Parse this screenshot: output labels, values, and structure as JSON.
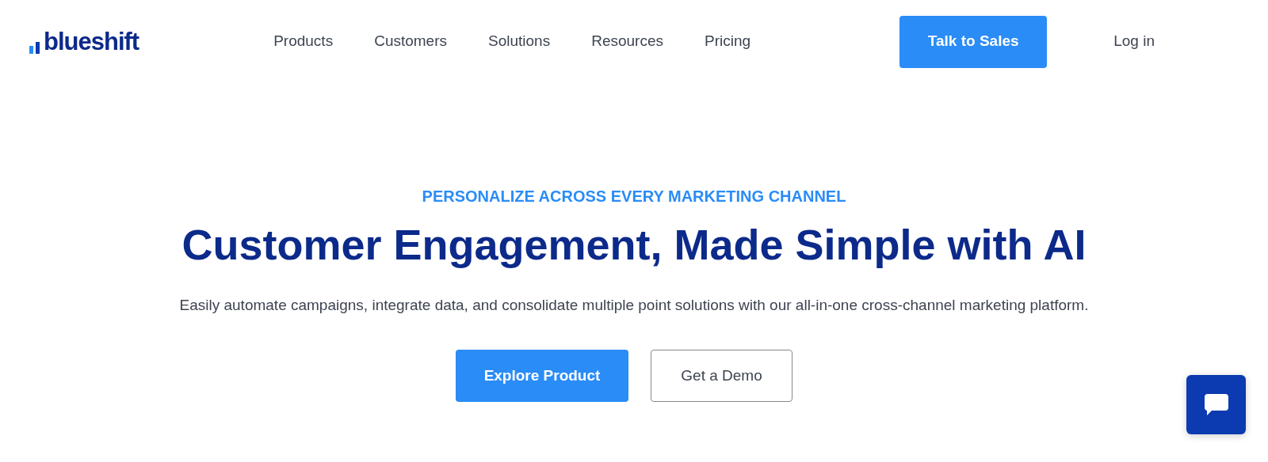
{
  "header": {
    "logo": "blueshift",
    "nav": [
      {
        "label": "Products"
      },
      {
        "label": "Customers"
      },
      {
        "label": "Solutions"
      },
      {
        "label": "Resources"
      },
      {
        "label": "Pricing"
      }
    ],
    "cta": "Talk to Sales",
    "login": "Log in"
  },
  "hero": {
    "eyebrow": "PERSONALIZE ACROSS EVERY MARKETING CHANNEL",
    "title": "Customer Engagement, Made Simple with AI",
    "subtitle": "Easily automate campaigns, integrate data, and consolidate multiple point solutions with our all-in-one cross-channel marketing platform.",
    "buttons": [
      {
        "label": "Explore Product",
        "kind": "primary"
      },
      {
        "label": "Get a Demo",
        "kind": "outline"
      }
    ]
  }
}
